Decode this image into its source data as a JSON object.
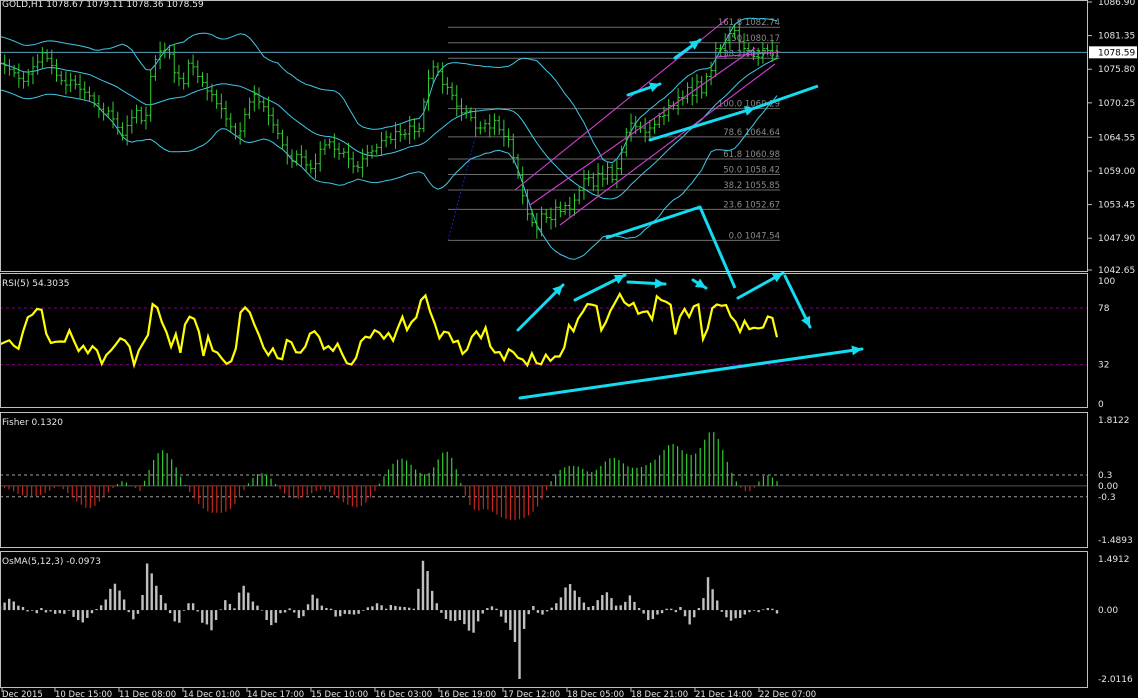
{
  "colors": {
    "background": "#000000",
    "frame": "#c0c0c0",
    "price_bars": "#32cd32",
    "bollinger": "#40c8e8",
    "level_line": "#5aa0c0",
    "fib_lines": "#6c6c6c",
    "fib_text": "#8a8a8a",
    "channel": "#d040d0",
    "fib_baseline": "#2020b0",
    "rsi_line": "#ffff00",
    "rsi_level": "#800080",
    "fisher_up": "#32cd32",
    "fisher_down": "#c8261e",
    "fisher_level": "#a0a0a0",
    "osma_bars": "#c0c0c0",
    "arrows": "#14dcf0",
    "axis_text": "#e6e6e6",
    "price_tag_bg": "#ffffff",
    "price_tag_text": "#000000"
  },
  "chart_data": [
    {
      "type": "line",
      "panel": "price",
      "title": "GOLD,H1  1078.67 1079.11 1078.36 1078.59",
      "symbol": "GOLD",
      "timeframe": "H1",
      "ohlc": {
        "open": 1078.67,
        "high": 1079.11,
        "low": 1078.36,
        "close": 1078.59
      },
      "current_price": 1078.59,
      "current_price_label": "1078.59",
      "ylim": [
        1042.65,
        1086.9
      ],
      "y_ticks": [
        "1086.90",
        "1081.35",
        "1075.80",
        "1070.25",
        "1064.55",
        "1059.00",
        "1053.45",
        "1047.90",
        "1042.65"
      ],
      "x_ticks": [
        "Dec 2015",
        "10 Dec 15:00",
        "11 Dec 08:00",
        "14 Dec 01:00",
        "14 Dec 17:00",
        "15 Dec 10:00",
        "16 Dec 03:00",
        "16 Dec 19:00",
        "17 Dec 12:00",
        "18 Dec 05:00",
        "18 Dec 21:00",
        "21 Dec 14:00",
        "22 Dec 07:00"
      ],
      "close": [
        1076.8,
        1076.4,
        1075.8,
        1075.2,
        1074.3,
        1073.8,
        1075.0,
        1076.2,
        1077.0,
        1078.5,
        1077.6,
        1076.4,
        1074.8,
        1073.9,
        1073.2,
        1074.0,
        1073.3,
        1072.5,
        1072.0,
        1071.4,
        1070.1,
        1069.2,
        1068.4,
        1068.9,
        1067.6,
        1066.2,
        1064.9,
        1066.5,
        1067.8,
        1069.0,
        1067.3,
        1068.2,
        1074.6,
        1077.4,
        1078.8,
        1079.0,
        1078.3,
        1075.2,
        1074.3,
        1073.4,
        1076.8,
        1076.2,
        1074.6,
        1073.6,
        1072.2,
        1071.6,
        1070.1,
        1069.3,
        1067.6,
        1066.3,
        1064.8,
        1065.6,
        1068.3,
        1070.4,
        1071.6,
        1070.4,
        1069.6,
        1068.2,
        1066.6,
        1065.2,
        1063.3,
        1061.5,
        1060.6,
        1061.7,
        1061.3,
        1060.0,
        1059.4,
        1060.2,
        1062.6,
        1063.3,
        1063.8,
        1062.6,
        1061.9,
        1062.1,
        1061.0,
        1059.8,
        1059.6,
        1061.0,
        1062.0,
        1062.3,
        1062.9,
        1064.0,
        1064.6,
        1064.2,
        1065.5,
        1065.0,
        1065.1,
        1066.4,
        1065.5,
        1066.0,
        1070.4,
        1074.3,
        1076.2,
        1075.4,
        1073.3,
        1072.8,
        1071.5,
        1069.7,
        1068.6,
        1068.9,
        1067.8,
        1066.1,
        1066.1,
        1066.8,
        1066.1,
        1067.3,
        1065.8,
        1064.7,
        1064.2,
        1061.2,
        1058.3,
        1054.9,
        1051.9,
        1050.5,
        1049.4,
        1051.9,
        1051.3,
        1051.0,
        1053.0,
        1052.3,
        1053.3,
        1052.7,
        1054.2,
        1055.8,
        1057.7,
        1057.9,
        1056.5,
        1058.6,
        1057.7,
        1059.6,
        1057.6,
        1059.4,
        1062.1,
        1065.4,
        1066.9,
        1066.3,
        1066.1,
        1065.4,
        1066.1,
        1066.7,
        1068.0,
        1068.2,
        1069.8,
        1069.8,
        1071.1,
        1071.0,
        1072.8,
        1071.5,
        1073.7,
        1071.9,
        1074.6,
        1075.6,
        1079.2,
        1079.2,
        1080.2,
        1081.7,
        1082.2,
        1080.4,
        1079.2,
        1078.9,
        1077.9,
        1077.8,
        1079.2,
        1078.9,
        1078.6,
        1078.6
      ],
      "fibonacci_levels": [
        {
          "ratio": "161.8",
          "price": "1082.74"
        },
        {
          "ratio": "150",
          "price": "1080.17"
        },
        {
          "ratio": "138.2",
          "price": "1077.61"
        },
        {
          "ratio": "100.0",
          "price": "1069.29"
        },
        {
          "ratio": "78.6",
          "price": "1064.64"
        },
        {
          "ratio": "61.8",
          "price": "1060.98"
        },
        {
          "ratio": "50.0",
          "price": "1058.42"
        },
        {
          "ratio": "38.2",
          "price": "1055.85"
        },
        {
          "ratio": "23.6",
          "price": "1052.67"
        },
        {
          "ratio": "0.0",
          "price": "1047.54"
        }
      ]
    },
    {
      "type": "line",
      "panel": "rsi",
      "title": "RSI(5) 54.3035",
      "indicator": "RSI(5)",
      "last_value": 54.3035,
      "ylim": [
        0,
        100
      ],
      "y_ticks": [
        "100",
        "78",
        "32",
        "0"
      ],
      "levels": [
        78,
        32
      ],
      "values": [
        48.5,
        50.2,
        51.8,
        47.3,
        44.9,
        59.0,
        70.6,
        72.6,
        77.3,
        76.6,
        57.0,
        49.6,
        50.6,
        50.8,
        50.7,
        59.9,
        51.3,
        43.1,
        47.3,
        41.3,
        47.0,
        43.5,
        32.6,
        39.9,
        43.6,
        48.2,
        53.3,
        51.6,
        46.8,
        31.8,
        43.5,
        49.8,
        56.2,
        81.2,
        78.3,
        66.5,
        58.3,
        46.6,
        56.8,
        41.6,
        64.6,
        71.0,
        69.2,
        58.9,
        39.1,
        54.8,
        43.4,
        41.8,
        36.8,
        32.7,
        34.9,
        45.4,
        74.4,
        78.5,
        74.4,
        64.5,
        55.9,
        45.8,
        39.7,
        45.1,
        37.3,
        36.4,
        52.0,
        50.2,
        42.1,
        41.8,
        46.7,
        57.2,
        59.1,
        54.6,
        44.7,
        47.1,
        43.2,
        49.0,
        40.4,
        33.2,
        32.1,
        37.6,
        50.8,
        54.7,
        53.9,
        60.0,
        58.0,
        53.1,
        57.7,
        51.5,
        61.8,
        70.8,
        60.1,
        66.6,
        70.4,
        84.4,
        88.3,
        75.1,
        65.3,
        53.4,
        58.8,
        58.0,
        50.2,
        51.4,
        40.7,
        44.2,
        54.6,
        59.0,
        53.6,
        62.2,
        46.8,
        41.8,
        42.3,
        35.6,
        44.5,
        42.1,
        37.6,
        36.3,
        31.5,
        41.1,
        33.3,
        32.3,
        40.1,
        35.0,
        38.6,
        38.6,
        45.9,
        64.2,
        59.1,
        69.4,
        74.9,
        81.2,
        80.7,
        79.7,
        60.0,
        66.6,
        75.9,
        82.4,
        89.4,
        82.6,
        79.8,
        82.2,
        73.3,
        74.9,
        75.3,
        68.7,
        87.6,
        84.4,
        83.2,
        80.7,
        56.6,
        70.9,
        77.3,
        70.8,
        79.4,
        81.0,
        52.7,
        61.1,
        78.0,
        80.9,
        79.8,
        80.4,
        71.1,
        67.1,
        58.6,
        67.6,
        60.8,
        62.0,
        61.5,
        62.3,
        71.1,
        69.9,
        54.3
      ]
    },
    {
      "type": "bar",
      "panel": "fisher",
      "title": "Fisher 0.1320",
      "indicator": "Fisher",
      "last_value": 0.132,
      "ylim": [
        -1.4893,
        1.8122
      ],
      "y_ticks": [
        "1.8122",
        "0.3",
        "0.00",
        "-0.3",
        "-1.4893"
      ],
      "levels": [
        0.3,
        -0.3
      ],
      "values": [
        0.0,
        -0.06,
        -0.1,
        -0.15,
        -0.22,
        -0.26,
        -0.3,
        -0.3,
        -0.28,
        -0.25,
        -0.2,
        -0.13,
        -0.06,
        -0.02,
        -0.09,
        -0.2,
        -0.32,
        -0.43,
        -0.52,
        -0.6,
        -0.61,
        -0.55,
        -0.43,
        -0.31,
        -0.18,
        -0.06,
        0.05,
        0.13,
        0.09,
        0.01,
        -0.06,
        -0.14,
        0.14,
        0.44,
        0.71,
        0.9,
        0.98,
        0.9,
        0.73,
        0.51,
        0.25,
        0.03,
        -0.17,
        -0.34,
        -0.5,
        -0.62,
        -0.7,
        -0.74,
        -0.74,
        -0.74,
        -0.71,
        -0.63,
        -0.5,
        -0.32,
        -0.12,
        0.07,
        0.22,
        0.32,
        0.35,
        0.32,
        0.2,
        0.05,
        -0.09,
        -0.22,
        -0.3,
        -0.34,
        -0.35,
        -0.32,
        -0.26,
        -0.2,
        -0.14,
        -0.11,
        -0.12,
        -0.17,
        -0.25,
        -0.35,
        -0.45,
        -0.52,
        -0.57,
        -0.59,
        -0.55,
        -0.46,
        -0.32,
        -0.14,
        0.06,
        0.26,
        0.45,
        0.61,
        0.72,
        0.75,
        0.7,
        0.58,
        0.45,
        0.36,
        0.32,
        0.36,
        0.51,
        0.73,
        0.91,
        0.94,
        0.77,
        0.46,
        0.08,
        -0.27,
        -0.53,
        -0.66,
        -0.68,
        -0.64,
        -0.65,
        -0.71,
        -0.79,
        -0.86,
        -0.91,
        -0.94,
        -0.94,
        -0.92,
        -0.88,
        -0.81,
        -0.71,
        -0.57,
        -0.37,
        -0.12,
        0.13,
        0.32,
        0.44,
        0.51,
        0.55,
        0.55,
        0.53,
        0.47,
        0.4,
        0.38,
        0.44,
        0.55,
        0.67,
        0.76,
        0.77,
        0.71,
        0.62,
        0.54,
        0.5,
        0.5,
        0.52,
        0.57,
        0.64,
        0.72,
        0.84,
        0.99,
        1.12,
        1.15,
        1.09,
        0.98,
        0.88,
        0.85,
        0.89,
        1.04,
        1.27,
        1.47,
        1.48,
        1.29,
        0.99,
        0.66,
        0.36,
        0.12,
        -0.05,
        -0.14,
        -0.15,
        -0.05,
        0.12,
        0.27,
        0.3,
        0.23,
        0.13
      ]
    },
    {
      "type": "bar",
      "panel": "osma",
      "title": "OsMA(5,12,3) -0.0973",
      "indicator": "OsMA(5,12,3)",
      "last_value": -0.0973,
      "ylim": [
        -2.0116,
        1.4912
      ],
      "y_ticks": [
        "1.4912",
        "0.00",
        "-2.0116"
      ],
      "values": [
        0.12,
        0.22,
        0.33,
        0.25,
        0.13,
        0.09,
        -0.04,
        -0.02,
        -0.09,
        0.06,
        -0.07,
        -0.04,
        -0.11,
        -0.09,
        -0.11,
        -0.02,
        -0.2,
        -0.29,
        -0.36,
        -0.23,
        -0.09,
        0.03,
        0.14,
        0.31,
        0.62,
        0.77,
        0.57,
        0.31,
        -0.06,
        -0.27,
        -0.11,
        0.44,
        1.36,
        1.07,
        0.71,
        0.44,
        0.2,
        -0.09,
        -0.33,
        -0.37,
        -0.02,
        0.2,
        0.2,
        -0.04,
        -0.37,
        -0.42,
        -0.59,
        -0.29,
        0.02,
        0.29,
        0.18,
        0.05,
        0.51,
        0.71,
        0.51,
        0.25,
        0.13,
        -0.01,
        -0.29,
        -0.44,
        -0.37,
        -0.09,
        -0.07,
        0.05,
        -0.07,
        -0.23,
        -0.18,
        0.17,
        0.45,
        0.34,
        0.13,
        0.06,
        0.04,
        -0.19,
        -0.18,
        -0.11,
        -0.12,
        -0.13,
        -0.11,
        -0.02,
        0.08,
        0.11,
        0.2,
        0.14,
        0.04,
        0.15,
        0.12,
        0.1,
        0.09,
        0.07,
        0.04,
        0.62,
        1.44,
        1.14,
        0.56,
        0.2,
        -0.08,
        -0.26,
        -0.31,
        -0.32,
        -0.29,
        -0.41,
        -0.6,
        -0.66,
        -0.33,
        -0.1,
        0.06,
        0.11,
        0.04,
        -0.19,
        -0.37,
        -0.58,
        -0.93,
        -2.01,
        -0.55,
        -0.12,
        0.12,
        -0.08,
        -0.13,
        -0.04,
        0.07,
        0.2,
        0.37,
        0.66,
        0.76,
        0.57,
        0.38,
        0.22,
        0.09,
        0.12,
        0.29,
        0.44,
        0.52,
        0.35,
        0.13,
        0.14,
        0.24,
        0.43,
        0.24,
        0.06,
        -0.1,
        -0.29,
        -0.26,
        -0.13,
        -0.09,
        0.04,
        0.04,
        -0.06,
        0.09,
        -0.18,
        -0.42,
        -0.21,
        0.06,
        0.35,
        0.96,
        0.61,
        0.28,
        -0.05,
        -0.21,
        -0.31,
        -0.24,
        -0.23,
        -0.13,
        -0.06,
        -0.02,
        -0.06,
        0.02,
        0.06,
        0.04,
        -0.1
      ]
    }
  ]
}
